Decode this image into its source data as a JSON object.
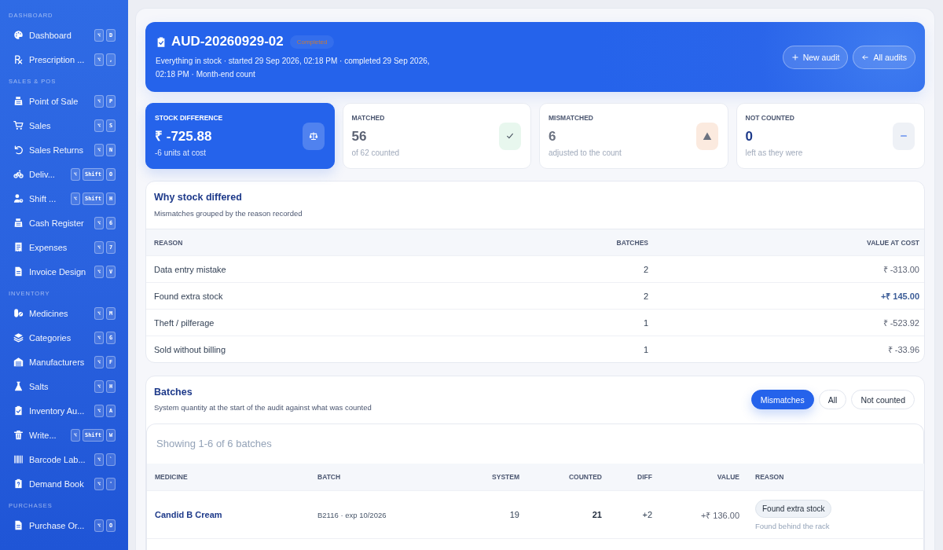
{
  "sidebar": {
    "sections": [
      {
        "label": "DASHBOARD",
        "items": [
          {
            "label": "Dashboard",
            "keys": [
              "⌥",
              "D"
            ]
          },
          {
            "label": "Prescription ...",
            "keys": [
              "⌥",
              ","
            ]
          }
        ]
      },
      {
        "label": "SALES & POS",
        "items": [
          {
            "label": "Point of Sale",
            "keys": [
              "⌥",
              "P"
            ]
          },
          {
            "label": "Sales",
            "keys": [
              "⌥",
              "S"
            ]
          },
          {
            "label": "Sales Returns",
            "keys": [
              "⌥",
              "N"
            ]
          },
          {
            "label": "Deliv...",
            "keys": [
              "⌥",
              "Shift",
              "O"
            ]
          },
          {
            "label": "Shift ...",
            "keys": [
              "⌥",
              "Shift",
              "H"
            ]
          },
          {
            "label": "Cash Register",
            "keys": [
              "⌥",
              "6"
            ]
          },
          {
            "label": "Expenses",
            "keys": [
              "⌥",
              "7"
            ]
          },
          {
            "label": "Invoice Design",
            "keys": [
              "⌥",
              "V"
            ]
          }
        ]
      },
      {
        "label": "INVENTORY",
        "items": [
          {
            "label": "Medicines",
            "keys": [
              "⌥",
              "M"
            ]
          },
          {
            "label": "Categories",
            "keys": [
              "⌥",
              "G"
            ]
          },
          {
            "label": "Manufacturers",
            "keys": [
              "⌥",
              "F"
            ]
          },
          {
            "label": "Salts",
            "keys": [
              "⌥",
              "H"
            ]
          },
          {
            "label": "Inventory Au...",
            "keys": [
              "⌥",
              "A"
            ]
          },
          {
            "label": "Write...",
            "keys": [
              "⌥",
              "Shift",
              "W"
            ]
          },
          {
            "label": "Barcode Lab...",
            "keys": [
              "⌥",
              "`"
            ]
          },
          {
            "label": "Demand Book",
            "keys": [
              "⌥",
              "'"
            ]
          }
        ]
      },
      {
        "label": "PURCHASES",
        "items": [
          {
            "label": "Purchase Or...",
            "keys": [
              "⌥",
              "O"
            ]
          }
        ]
      }
    ]
  },
  "header": {
    "title": "AUD-20260929-02",
    "status": "Completed",
    "description": "Everything in stock · started 29 Sep 2026, 02:18 PM · completed 29 Sep 2026, 02:18 PM · Month-end count",
    "buttons": [
      {
        "label": "New audit",
        "kind": "new"
      },
      {
        "label": "All audits",
        "kind": "back"
      }
    ]
  },
  "stats": [
    {
      "kind": "primary",
      "label": "STOCK DIFFERENCE",
      "value": "₹ -725.88",
      "note": "-6 units at cost"
    },
    {
      "kind": "success",
      "label": "MATCHED",
      "value": "56",
      "note": "of 62 counted"
    },
    {
      "kind": "warning",
      "label": "MISMATCHED",
      "value": "6",
      "note": "adjusted to the count"
    },
    {
      "kind": "neutral",
      "label": "NOT COUNTED",
      "value": "0",
      "note": "left as they were"
    }
  ],
  "reasons": {
    "title": "Why stock differed",
    "subtitle": "Mismatches grouped by the reason recorded",
    "columns": [
      "REASON",
      "BATCHES",
      "VALUE AT COST"
    ],
    "rows": [
      {
        "reason": "Data entry mistake",
        "batches": "2",
        "value": "₹ -313.00",
        "positive": false
      },
      {
        "reason": "Found extra stock",
        "batches": "2",
        "value": "+₹ 145.00",
        "positive": true
      },
      {
        "reason": "Theft / pilferage",
        "batches": "1",
        "value": "₹ -523.92",
        "positive": false
      },
      {
        "reason": "Sold without billing",
        "batches": "1",
        "value": "₹ -33.96",
        "positive": false
      }
    ]
  },
  "batches": {
    "title": "Batches",
    "subtitle": "System quantity at the start of the audit against what was counted",
    "filters": [
      {
        "label": "Mismatches",
        "selected": true
      },
      {
        "label": "All",
        "selected": false
      },
      {
        "label": "Not counted",
        "selected": false
      }
    ],
    "summary": "Showing 1-6 of 6 batches",
    "columns": [
      "MEDICINE",
      "BATCH",
      "SYSTEM",
      "COUNTED",
      "DIFF",
      "VALUE",
      "REASON"
    ],
    "rows": [
      {
        "medicine": "Candid B Cream",
        "batch": "B2116 · exp 10/2026",
        "system": "19",
        "counted": "21",
        "diff": "+2",
        "value": "+₹ 136.00",
        "reason": "Found extra stock",
        "note": "Found behind the rack"
      }
    ]
  }
}
